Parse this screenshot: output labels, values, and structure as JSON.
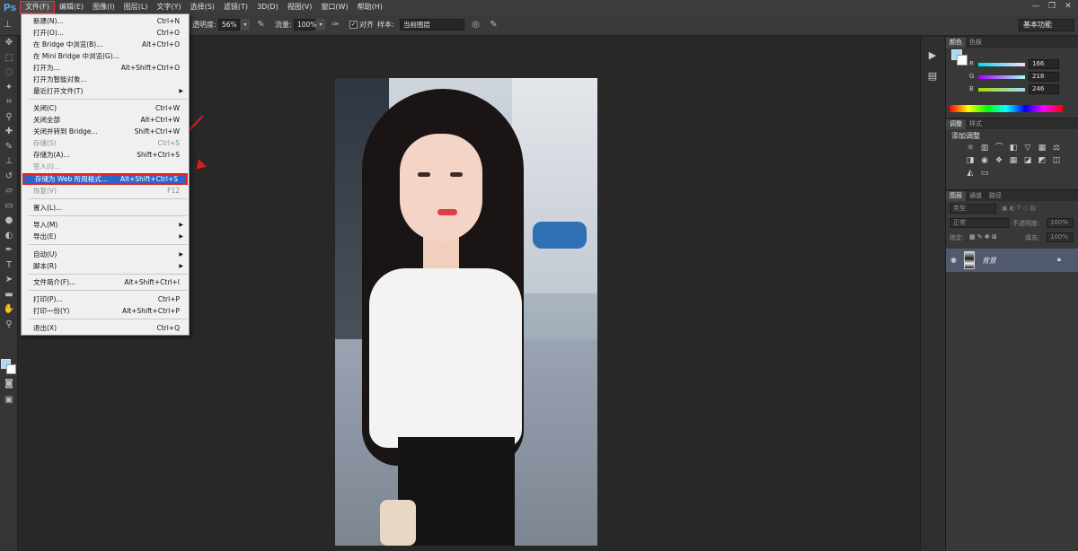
{
  "app": {
    "logo": "Ps",
    "menu": [
      "文件(F)",
      "编辑(E)",
      "图像(I)",
      "图层(L)",
      "文字(Y)",
      "选择(S)",
      "滤镜(T)",
      "3D(D)",
      "视图(V)",
      "窗口(W)",
      "帮助(H)"
    ],
    "window_controls": [
      "—",
      "❐",
      "✕"
    ]
  },
  "options_bar": {
    "opacity_label": "透明度:",
    "opacity_value": "56%",
    "flow_label": "流量:",
    "flow_value": "100%",
    "align_label": "对齐",
    "sample_label": "样本:",
    "sample_value": "当前图层",
    "workspace": "基本功能"
  },
  "file_menu": [
    {
      "label": "新建(N)...",
      "shortcut": "Ctrl+N"
    },
    {
      "label": "打开(O)...",
      "shortcut": "Ctrl+O"
    },
    {
      "label": "在 Bridge 中浏览(B)...",
      "shortcut": "Alt+Ctrl+O"
    },
    {
      "label": "在 Mini Bridge 中浏览(G)...",
      "shortcut": ""
    },
    {
      "label": "打开为...",
      "shortcut": "Alt+Shift+Ctrl+O"
    },
    {
      "label": "打开为智能对象...",
      "shortcut": ""
    },
    {
      "label": "最近打开文件(T)",
      "shortcut": "",
      "submenu": true
    },
    {
      "label": "关闭(C)",
      "shortcut": "Ctrl+W"
    },
    {
      "label": "关闭全部",
      "shortcut": "Alt+Ctrl+W"
    },
    {
      "label": "关闭并转到 Bridge...",
      "shortcut": "Shift+Ctrl+W"
    },
    {
      "label": "存储(S)",
      "shortcut": "Ctrl+S",
      "disabled": true
    },
    {
      "label": "存储为(A)...",
      "shortcut": "Shift+Ctrl+S"
    },
    {
      "label": "签入(I)...",
      "shortcut": "",
      "disabled": true
    },
    {
      "label": "存储为 Web 所用格式...",
      "shortcut": "Alt+Shift+Ctrl+S",
      "highlighted": true
    },
    {
      "label": "恢复(V)",
      "shortcut": "F12",
      "disabled": true
    },
    {
      "label": "置入(L)...",
      "shortcut": ""
    },
    {
      "label": "导入(M)",
      "shortcut": "",
      "submenu": true
    },
    {
      "label": "导出(E)",
      "shortcut": "",
      "submenu": true
    },
    {
      "label": "自动(U)",
      "shortcut": "",
      "submenu": true
    },
    {
      "label": "脚本(R)",
      "shortcut": "",
      "submenu": true
    },
    {
      "label": "文件简介(F)...",
      "shortcut": "Alt+Shift+Ctrl+I"
    },
    {
      "label": "打印(P)...",
      "shortcut": "Ctrl+P"
    },
    {
      "label": "打印一份(Y)",
      "shortcut": "Alt+Shift+Ctrl+P"
    },
    {
      "label": "退出(X)",
      "shortcut": "Ctrl+Q"
    }
  ],
  "color_panel": {
    "tabs": [
      "颜色",
      "色板"
    ],
    "r_label": "R",
    "r": "166",
    "g_label": "G",
    "g": "218",
    "b_label": "B",
    "b": "246",
    "foreground": "#a6daf6",
    "background": "#ffffff"
  },
  "adjustments_panel": {
    "tabs": [
      "调整",
      "样式"
    ],
    "title": "添加调整"
  },
  "layers_panel": {
    "tabs": [
      "图层",
      "通道",
      "路径"
    ],
    "filter": "类型",
    "blend_mode": "正常",
    "opacity_label": "不透明度:",
    "opacity_value": "100%",
    "lock_label": "锁定:",
    "fill_label": "填充:",
    "fill_value": "100%",
    "layer_name": "背景"
  }
}
